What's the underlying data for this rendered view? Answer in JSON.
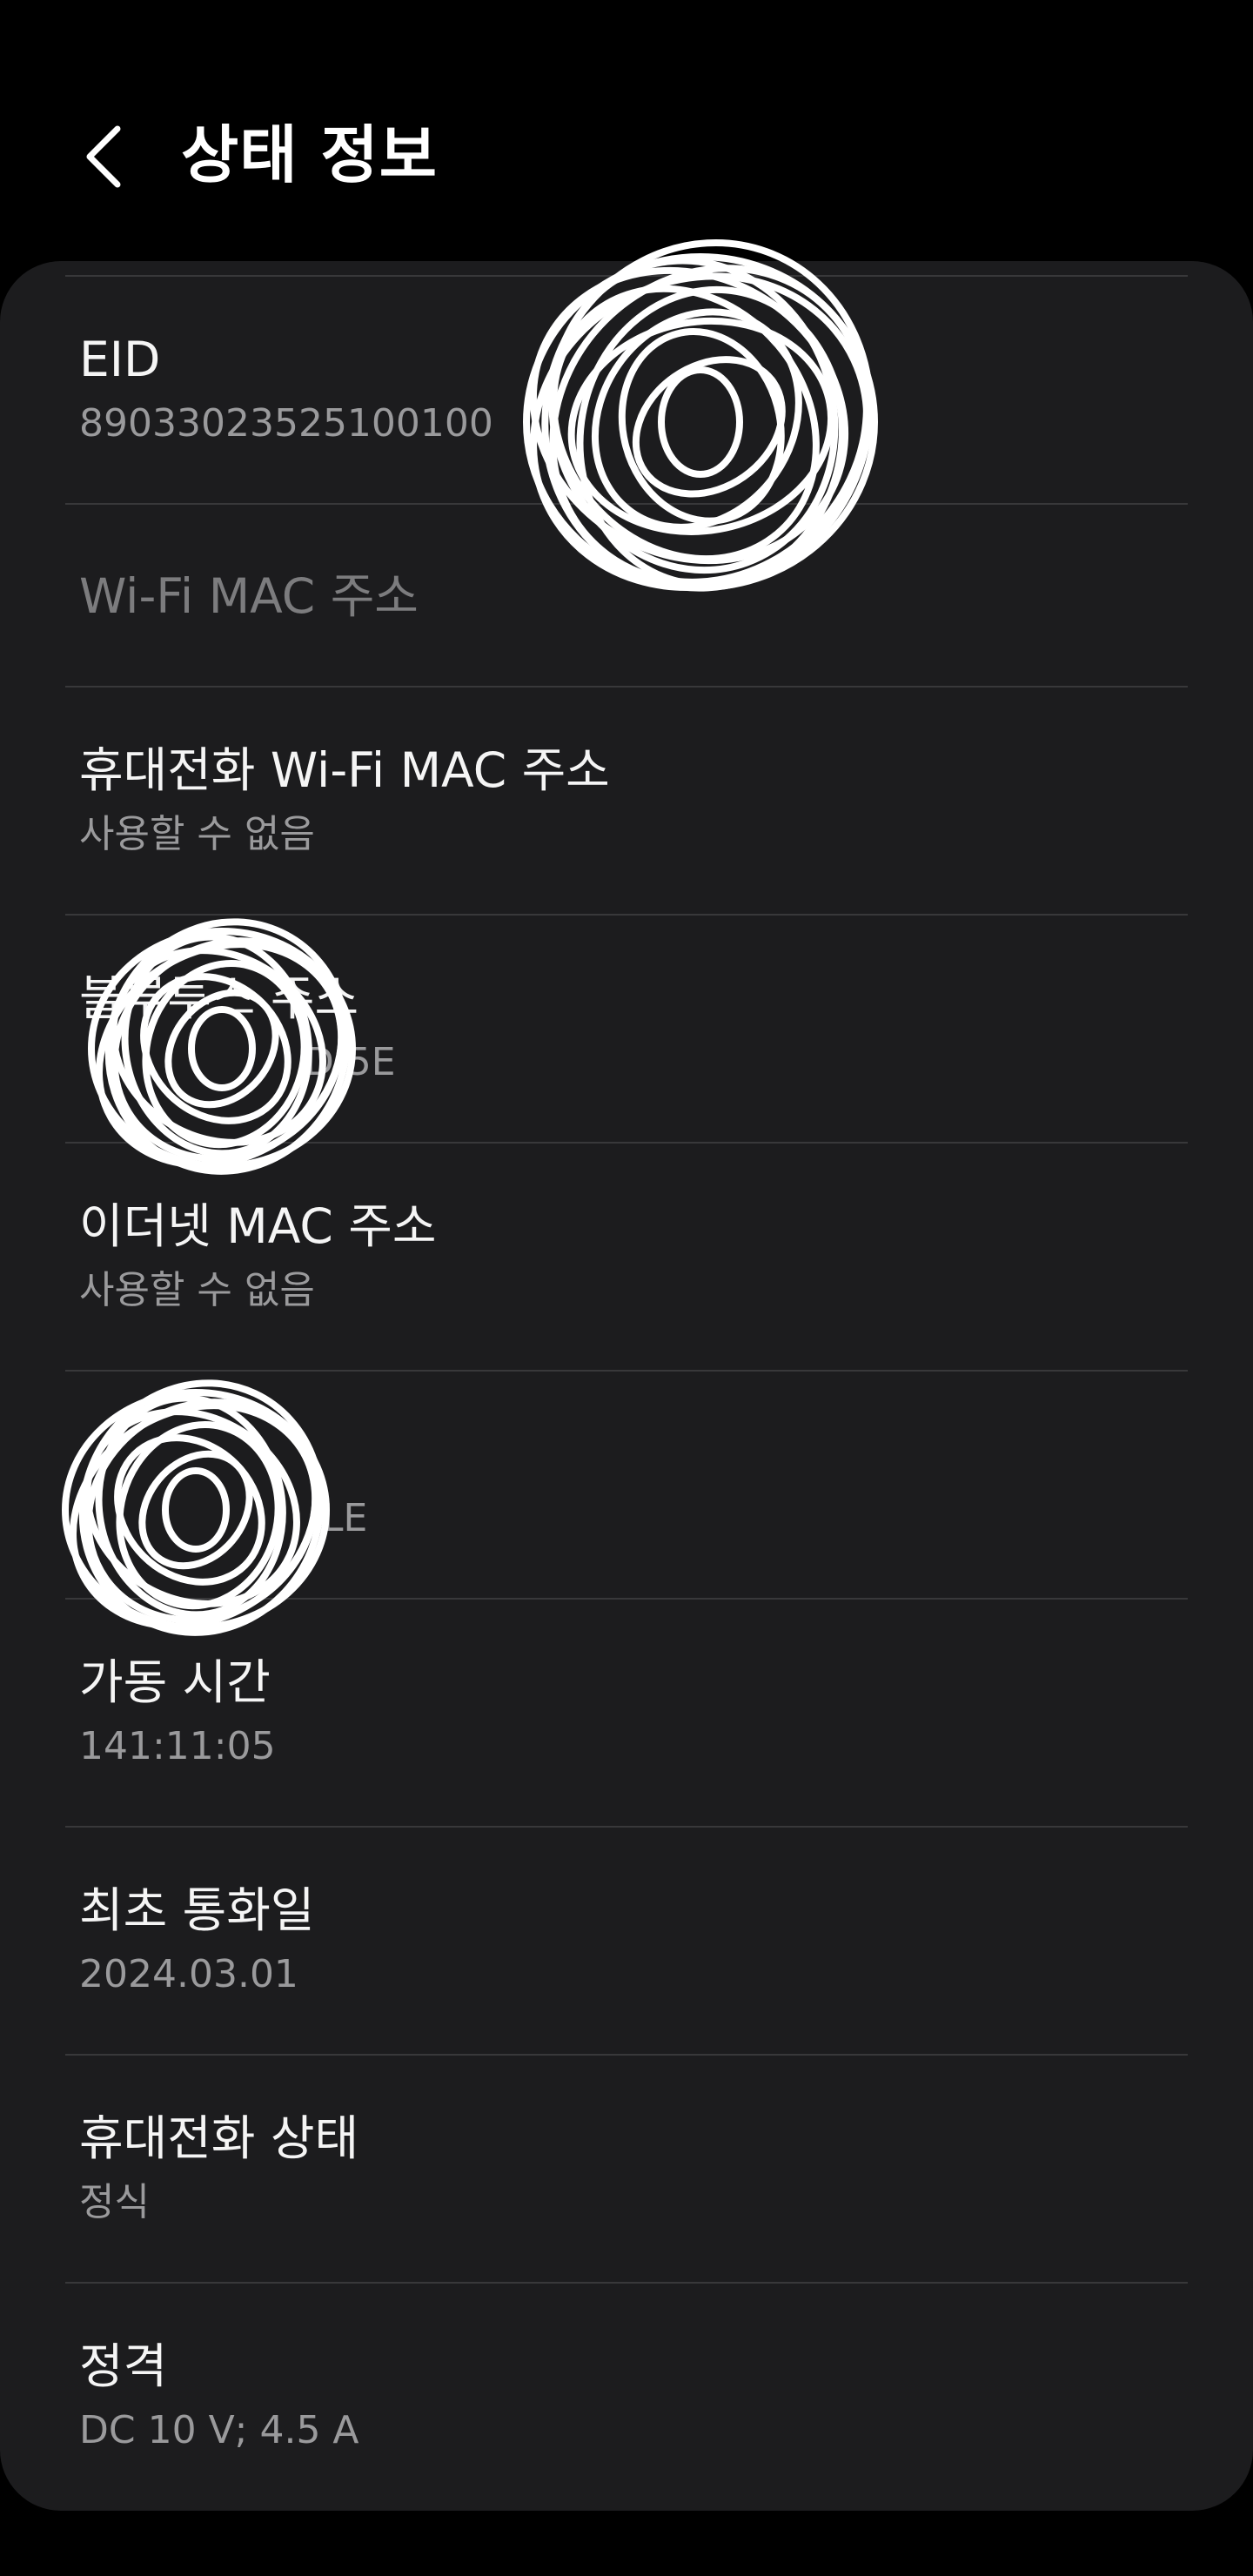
{
  "header": {
    "back_icon": "chevron-left-icon",
    "title": "상태 정보"
  },
  "items": [
    {
      "title": "EID",
      "subtitle": "89033023525100100",
      "enabled": true
    },
    {
      "title": "Wi-Fi MAC 주소",
      "subtitle": "",
      "enabled": false
    },
    {
      "title": "휴대전화 Wi-Fi MAC 주소",
      "subtitle": "사용할 수 없음",
      "enabled": true
    },
    {
      "title": "블루투스 주소",
      "subtitle": "D:5E",
      "enabled": true
    },
    {
      "title": "이더넷 MAC 주소",
      "subtitle": "사용할 수 없음",
      "enabled": true
    },
    {
      "title": "",
      "subtitle": "LE",
      "enabled": true
    },
    {
      "title": "가동 시간",
      "subtitle": "141:11:05",
      "enabled": true
    },
    {
      "title": "최초 통화일",
      "subtitle": "2024.03.01",
      "enabled": true
    },
    {
      "title": "휴대전화 상태",
      "subtitle": "정식",
      "enabled": true
    },
    {
      "title": "정격",
      "subtitle": "DC 10 V; 4.5 A",
      "enabled": true
    }
  ],
  "colors": {
    "background": "#000000",
    "card": "#1c1c1e",
    "divider": "#38383a",
    "primary_text": "#f5f5f5",
    "secondary_text": "#9a9a9c",
    "disabled_text": "#7c7c7e",
    "redaction": "#ffffff"
  }
}
